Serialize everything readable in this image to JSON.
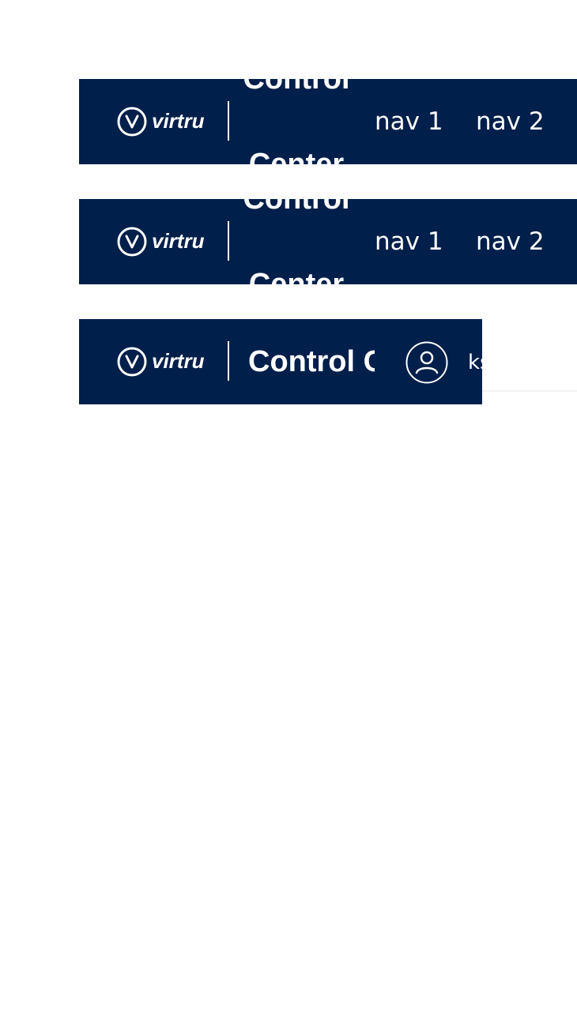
{
  "brand": {
    "logo_text": "virtru",
    "product_title": "Control Center",
    "color_navy": "#001f4a",
    "color_white": "#ffffff"
  },
  "headers": [
    {
      "variant": "nav-links",
      "nav": [
        "nav 1",
        "nav 2"
      ]
    },
    {
      "variant": "nav-links",
      "nav": [
        "nav 1",
        "nav 2"
      ]
    },
    {
      "variant": "user",
      "user_name": "ks"
    }
  ],
  "icons": {
    "logo": "virtru-logo-icon",
    "user": "user-avatar-icon"
  }
}
